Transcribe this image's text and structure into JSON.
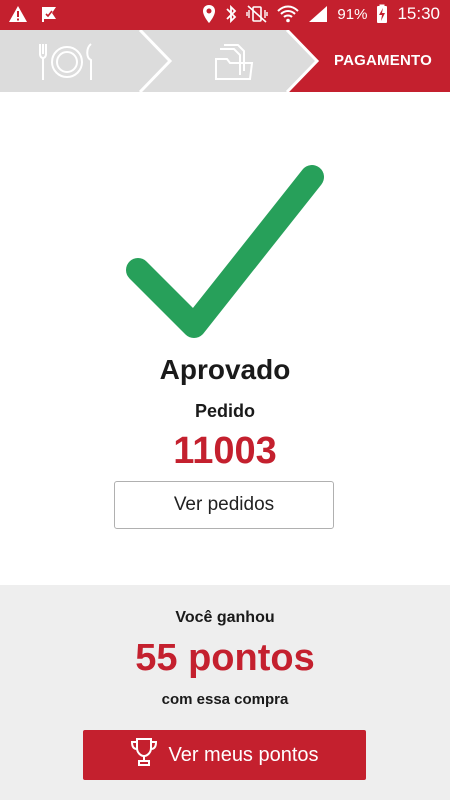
{
  "status_bar": {
    "battery": "91%",
    "time": "15:30"
  },
  "stepper": {
    "steps": [
      {
        "icon": "restaurant-icon"
      },
      {
        "icon": "documents-icon"
      },
      {
        "label": "PAGAMENTO"
      }
    ]
  },
  "result": {
    "title": "Aprovado",
    "order_label": "Pedido",
    "order_number": "11003",
    "view_orders_button": "Ver pedidos"
  },
  "rewards": {
    "earned_label": "Você ganhou",
    "points": "55 pontos",
    "purchase_label": "com essa compra",
    "view_points_button": "Ver meus pontos",
    "button_icon": "trophy-icon"
  },
  "colors": {
    "brand": "#c4202e",
    "success": "#27a05a"
  }
}
